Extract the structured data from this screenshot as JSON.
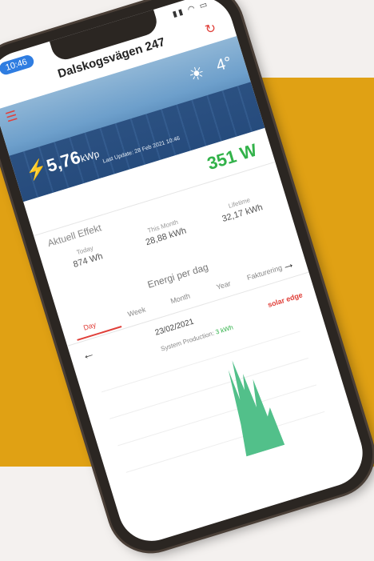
{
  "status": {
    "time": "10:46",
    "icons": "▮▮ ◠ ▭"
  },
  "header": {
    "title": "Dalskogsvägen 247",
    "share_icon": "share-icon",
    "menu_icon": "hamburger-icon"
  },
  "hero": {
    "temp": "4°",
    "kwp_value": "5,76",
    "kwp_unit": "kWp",
    "last_update": "Last Update: 28 Feb 2021 10:46"
  },
  "power": {
    "label": "Aktuell Effekt",
    "value": "351 W"
  },
  "stats": [
    {
      "label": "Today",
      "value": "874 Wh"
    },
    {
      "label": "This Month",
      "value": "28,88 kWh"
    },
    {
      "label": "Lifetime",
      "value": "32,17 kWh"
    }
  ],
  "energy": {
    "title": "Energi per dag"
  },
  "tabs": [
    {
      "label": "Day",
      "active": true
    },
    {
      "label": "Week",
      "active": false
    },
    {
      "label": "Month",
      "active": false
    },
    {
      "label": "Year",
      "active": false
    },
    {
      "label": "Fakturering",
      "active": false
    }
  ],
  "date": {
    "value": "23/02/2021"
  },
  "system": {
    "label": "System Production:",
    "value": "3 kWh",
    "brand": "solar edge"
  },
  "colors": {
    "accent": "#e0403a",
    "green": "#32b24a",
    "gold": "#e0a114"
  }
}
